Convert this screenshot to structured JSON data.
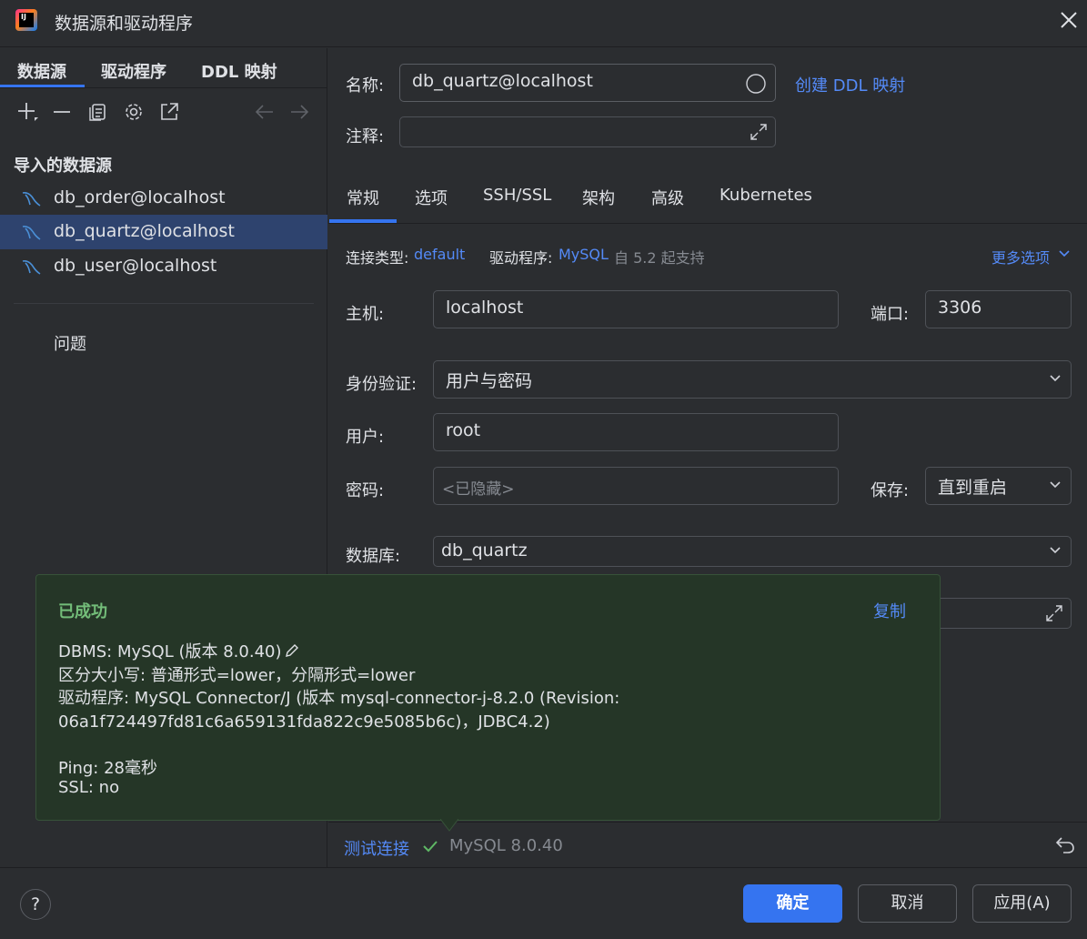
{
  "window": {
    "title": "数据源和驱动程序",
    "app_icon_text": "IJ"
  },
  "left": {
    "tabs": [
      "数据源",
      "驱动程序",
      "DDL 映射"
    ],
    "section_title": "导入的数据源",
    "datasources": [
      "db_order@localhost",
      "db_quartz@localhost",
      "db_user@localhost"
    ],
    "problems": "问题"
  },
  "form": {
    "name_label": "名称:",
    "name_value": "db_quartz@localhost",
    "create_ddl": "创建 DDL 映射",
    "comment_label": "注释:",
    "tabs": [
      "常规",
      "选项",
      "SSH/SSL",
      "架构",
      "高级",
      "Kubernetes"
    ],
    "conn_type_label": "连接类型:",
    "conn_type_value": "default",
    "driver_label": "驱动程序:",
    "driver_value": "MySQL",
    "driver_note": "自 5.2 起支持",
    "more_options": "更多选项",
    "host_label": "主机:",
    "host_value": "localhost",
    "port_label": "端口:",
    "port_value": "3306",
    "auth_label": "身份验证:",
    "auth_value": "用户与密码",
    "user_label": "用户:",
    "user_value": "root",
    "password_label": "密码:",
    "password_placeholder": "<已隐藏>",
    "save_label": "保存:",
    "save_value": "直到重启",
    "db_label": "数据库:",
    "db_value": "db_quartz"
  },
  "popup": {
    "title": "已成功",
    "copy": "复制",
    "lines": [
      "DBMS: MySQL (版本 8.0.40)",
      "区分大小写: 普通形式=lower，分隔形式=lower",
      "驱动程序: MySQL Connector/J (版本 mysql-connector-j-8.2.0 (Revision:",
      "06a1f724497fd81c6a659131fda822c9e5085b6c)，JDBC4.2)",
      "Ping: 28毫秒",
      "SSL: no"
    ]
  },
  "test": {
    "label": "测试连接",
    "result": "MySQL 8.0.40"
  },
  "buttons": {
    "ok": "确定",
    "cancel": "取消",
    "apply": "应用(A)",
    "help": "?"
  },
  "colors": {
    "accent": "#3574f0",
    "link": "#548af7",
    "success": "#73bd79",
    "popup_bg": "#253627"
  }
}
